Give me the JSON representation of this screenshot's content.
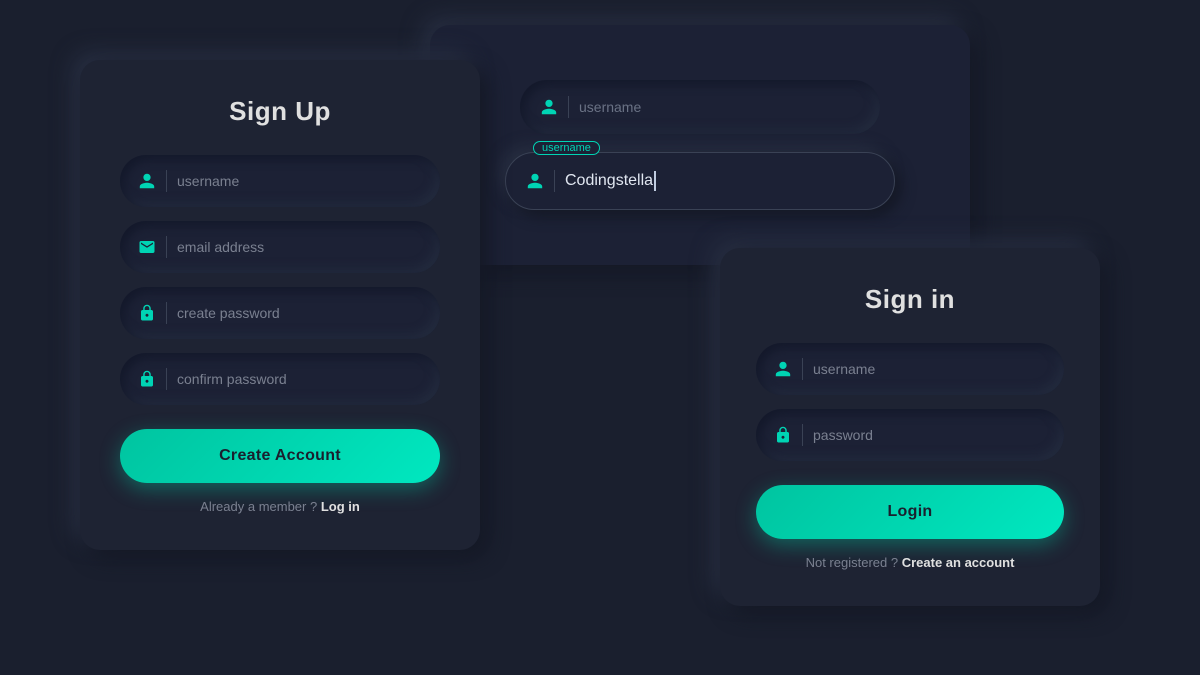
{
  "background_color": "#1a1f2e",
  "inputs_panel": {
    "plain_input": {
      "placeholder": "username"
    },
    "active_input": {
      "label": "username",
      "value": "Codingstella"
    }
  },
  "signup_card": {
    "title": "Sign Up",
    "fields": [
      {
        "id": "signup-username",
        "placeholder": "username",
        "type": "text",
        "icon": "user"
      },
      {
        "id": "signup-email",
        "placeholder": "email address",
        "type": "email",
        "icon": "email"
      },
      {
        "id": "signup-password",
        "placeholder": "create password",
        "type": "password",
        "icon": "lock"
      },
      {
        "id": "signup-confirm",
        "placeholder": "confirm password",
        "type": "password",
        "icon": "lock"
      }
    ],
    "button_label": "Create Account",
    "footer_text": "Already a member ?",
    "footer_link": "Log in"
  },
  "signin_card": {
    "title": "Sign in",
    "fields": [
      {
        "id": "signin-username",
        "placeholder": "username",
        "type": "text",
        "icon": "user"
      },
      {
        "id": "signin-password",
        "placeholder": "password",
        "type": "password",
        "icon": "lock"
      }
    ],
    "button_label": "Login",
    "footer_text": "Not registered ?",
    "footer_link": "Create an account"
  }
}
